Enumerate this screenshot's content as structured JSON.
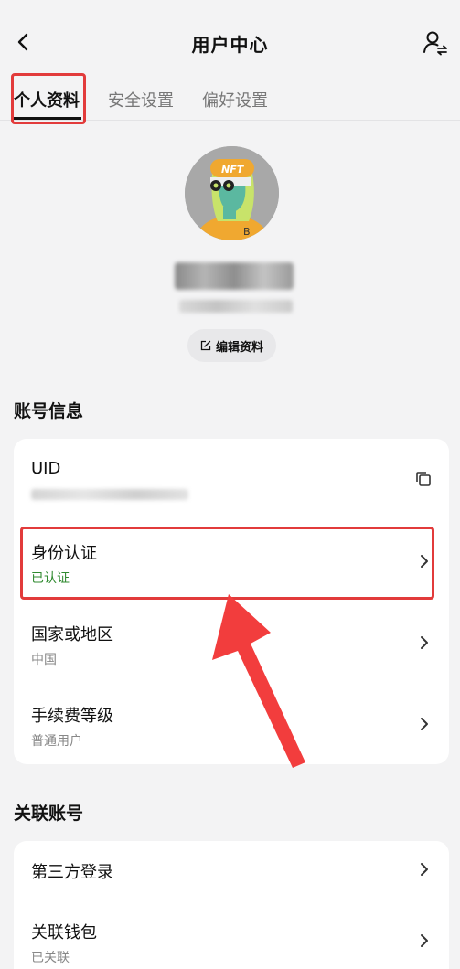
{
  "header": {
    "title": "用户中心"
  },
  "tabs": [
    {
      "label": "个人资料",
      "active": true
    },
    {
      "label": "安全设置",
      "active": false
    },
    {
      "label": "偏好设置",
      "active": false
    }
  ],
  "profile": {
    "edit_label": "编辑资料",
    "avatar_badge": "NFT"
  },
  "account_section": {
    "title": "账号信息",
    "rows": [
      {
        "title": "UID",
        "subtitle": ""
      },
      {
        "title": "身份认证",
        "subtitle": "已认证"
      },
      {
        "title": "国家或地区",
        "subtitle": "中国"
      },
      {
        "title": "手续费等级",
        "subtitle": "普通用户"
      }
    ]
  },
  "linked_section": {
    "title": "关联账号",
    "rows": [
      {
        "title": "第三方登录",
        "subtitle": ""
      },
      {
        "title": "关联钱包",
        "subtitle": "已关联"
      }
    ]
  },
  "colors": {
    "highlight": "#e23b3b",
    "verified": "#2f8a2f"
  }
}
